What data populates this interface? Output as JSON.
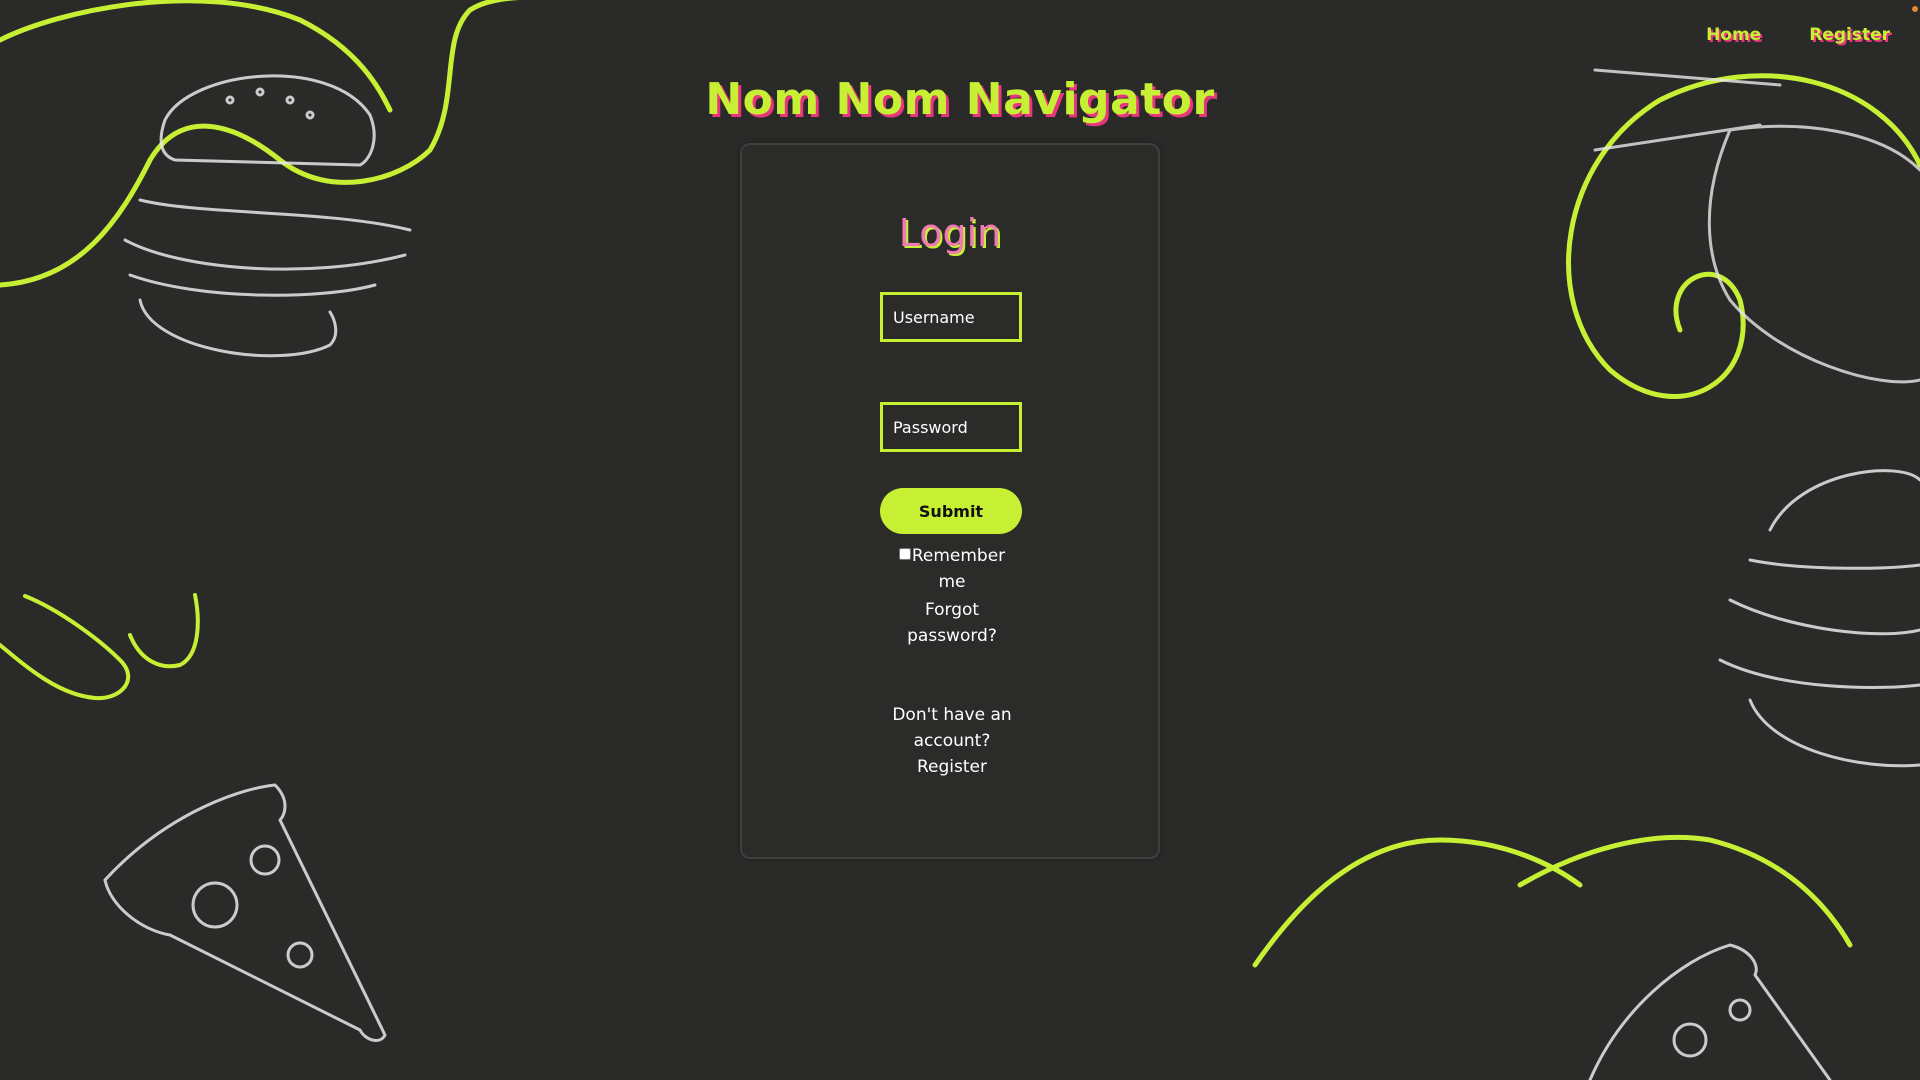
{
  "nav": {
    "home_label": "Home",
    "register_label": "Register"
  },
  "site": {
    "title": "Nom Nom Navigator"
  },
  "login": {
    "heading": "Login",
    "username_placeholder": "Username",
    "password_placeholder": "Password",
    "submit_label": "Submit",
    "remember_label": "Remember me",
    "forgot_label": "Forgot password?",
    "no_account_text": "Don't have an account?",
    "register_link": "Register"
  },
  "colors": {
    "background": "#2a2b29",
    "accent_green": "#c7f035",
    "accent_pink": "#e8357e",
    "text": "#ffffff"
  },
  "background_icons": [
    "burger-icon",
    "noodle-bowl-icon",
    "pizza-slice-icon"
  ]
}
